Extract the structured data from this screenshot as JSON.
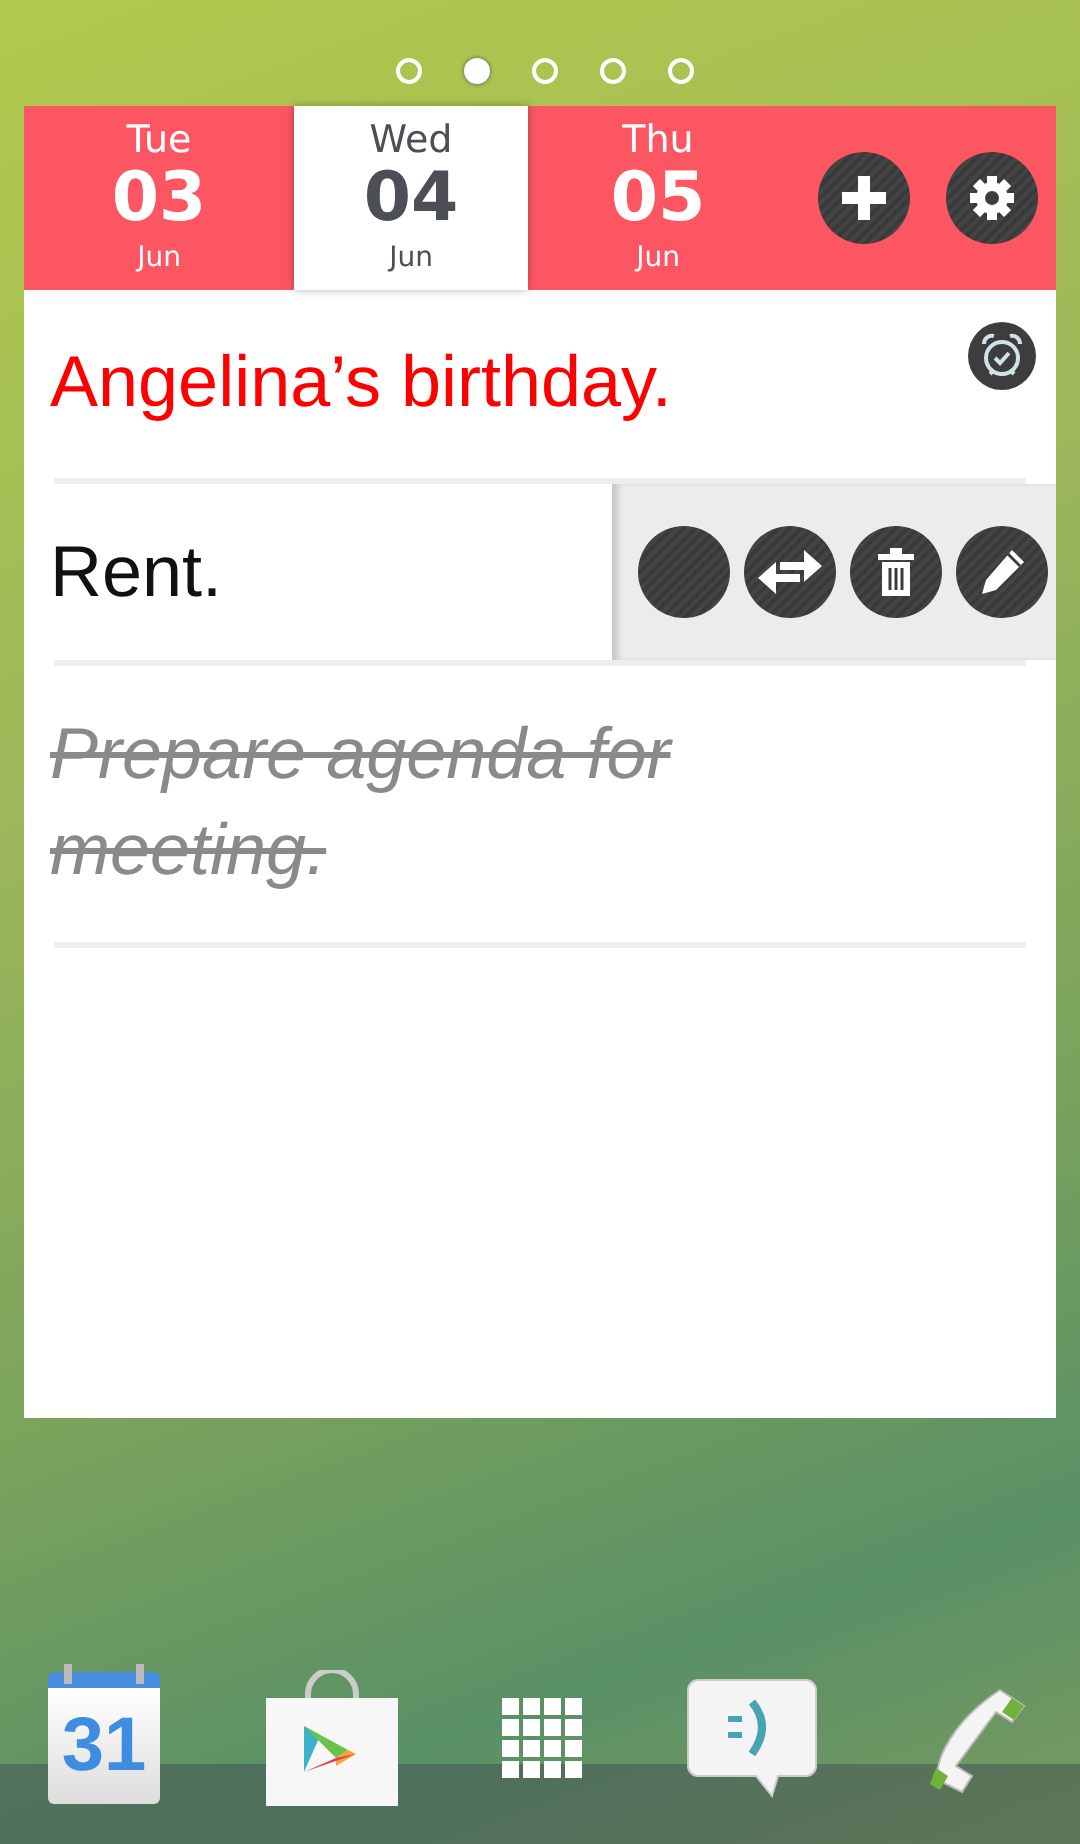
{
  "pager": [
    {
      "selected": false
    },
    {
      "selected": true
    },
    {
      "selected": false
    },
    {
      "selected": false
    },
    {
      "selected": false
    }
  ],
  "days": [
    {
      "weekday": "Tue",
      "date": "03",
      "month": "Jun",
      "selected": false
    },
    {
      "weekday": "Wed",
      "date": "04",
      "month": "Jun",
      "selected": true
    },
    {
      "weekday": "Thu",
      "date": "05",
      "month": "Jun",
      "selected": false
    }
  ],
  "tasks": [
    {
      "text": "Angelina’s birthday.",
      "color": "#ff0000",
      "done": false,
      "alarm": true,
      "actions_open": false
    },
    {
      "text": "Rent.",
      "color": "#111111",
      "done": false,
      "alarm": false,
      "actions_open": true
    },
    {
      "text": "Prepare agenda for meeting.",
      "color": "#8a8a8a",
      "done": true,
      "alarm": false,
      "actions_open": false
    }
  ],
  "dock": [
    {
      "kind": "calendar",
      "label": "31"
    },
    {
      "kind": "store"
    },
    {
      "kind": "apps"
    },
    {
      "kind": "messages"
    },
    {
      "kind": "phone"
    }
  ]
}
